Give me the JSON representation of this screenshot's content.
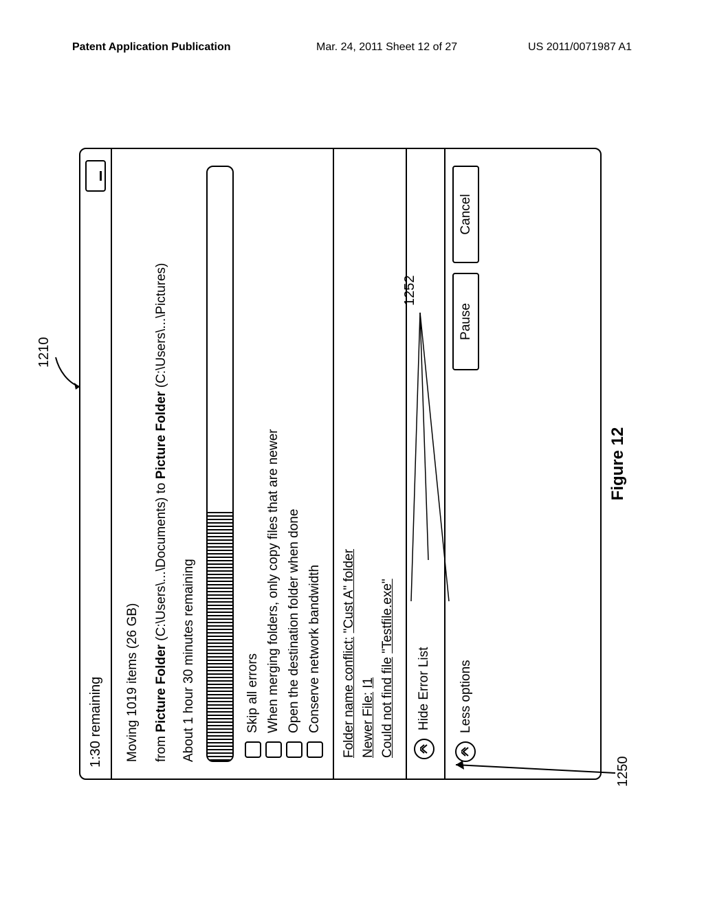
{
  "header": {
    "left": "Patent Application Publication",
    "center": "Mar. 24, 2011  Sheet 12 of 27",
    "right": "US 2011/0071987 A1"
  },
  "refs": {
    "r1210": "1210",
    "r1252": "1252",
    "r1250": "1250"
  },
  "dialog": {
    "titlebar": "1:30 remaining",
    "heading": "Moving 1019 items (26 GB)",
    "from_prefix": "from ",
    "from_folder": "Picture Folder",
    "from_path": " (C:\\Users\\...\\Documents) to ",
    "to_folder": "Picture Folder",
    "to_path": " (C:\\Users\\...\\Pictures)",
    "remaining": "About 1 hour 30 minutes remaining",
    "options": {
      "o1": "Skip all errors",
      "o2": "When merging folders, only copy files that are newer",
      "o3": "Open the destination folder when done",
      "o4": "Conserve network bandwidth"
    },
    "errors": {
      "e1_a": "Folder name conflict:",
      "e1_b": "\"Cust A\" folder",
      "e2_a": "Newer File:",
      "e2_b": "I1",
      "e3_a": "Could not find file",
      "e3_b": "\"Testfile.exe\""
    },
    "hideErr": "Hide Error List",
    "lessOpt": "Less options",
    "buttons": {
      "pause": "Pause",
      "cancel": "Cancel"
    }
  },
  "caption": "Figure 12"
}
